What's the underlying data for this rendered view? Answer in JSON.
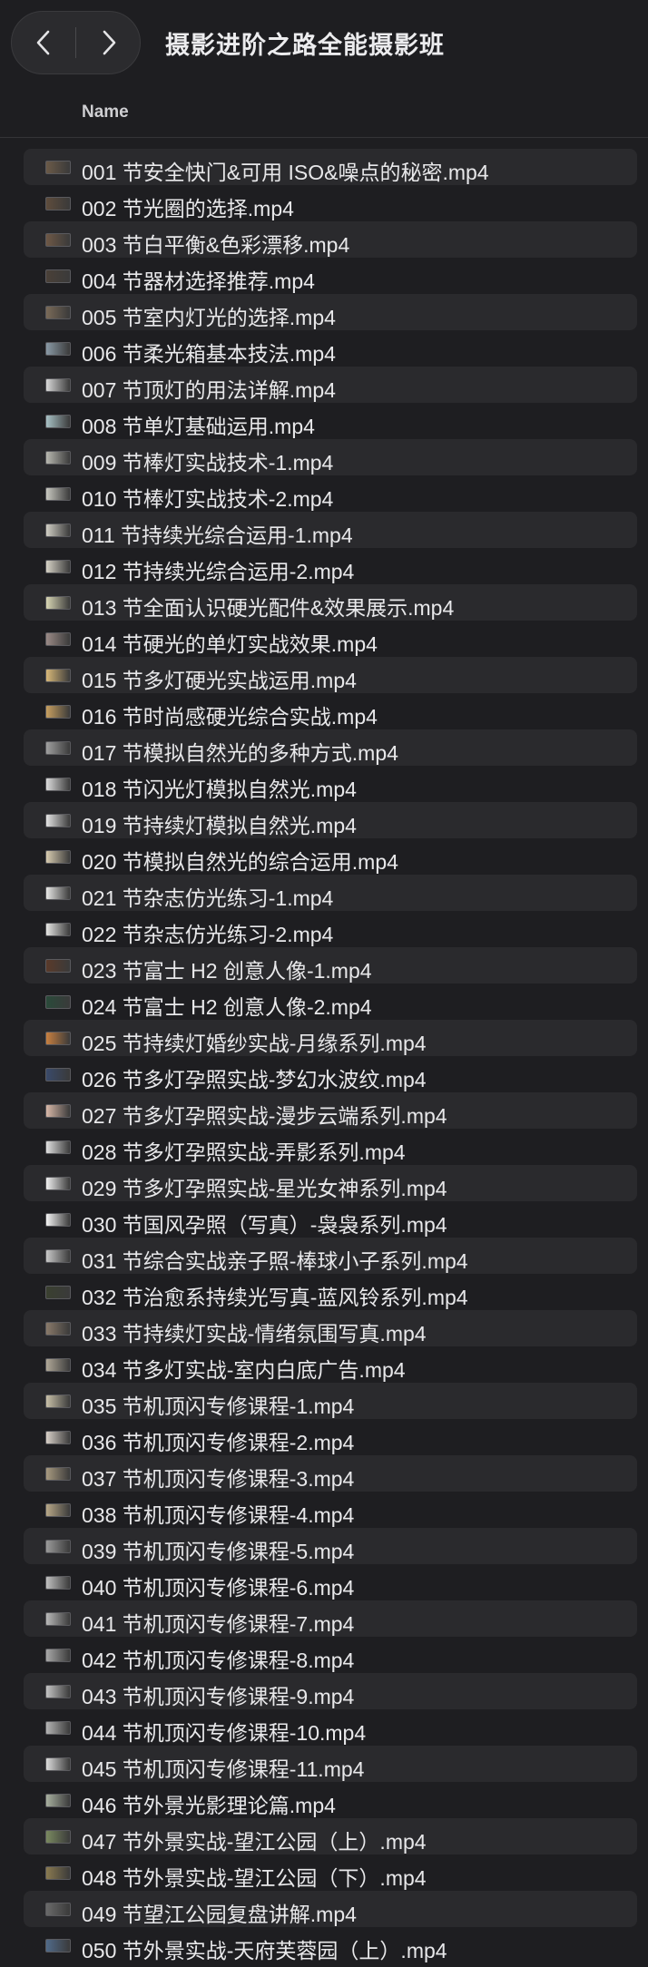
{
  "window": {
    "title": "摄影进阶之路全能摄影班"
  },
  "toolbar": {
    "back_icon": "chevron-left-icon",
    "forward_icon": "chevron-right-icon"
  },
  "columns": {
    "name": "Name"
  },
  "colors": {
    "background": "#1e1e21",
    "row_stripe": "#2a2a2d",
    "text": "#e8e8ea"
  },
  "files": [
    {
      "name": "001 节安全快门&可用 ISO&噪点的秘密.mp4",
      "thumb": "#6b5a48"
    },
    {
      "name": "002 节光圈的选择.mp4",
      "thumb": "#5e4c3c"
    },
    {
      "name": "003 节白平衡&色彩漂移.mp4",
      "thumb": "#6e5846"
    },
    {
      "name": "004 节器材选择推荐.mp4",
      "thumb": "#4a4038"
    },
    {
      "name": "005 节室内灯光的选择.mp4",
      "thumb": "#7a6a58"
    },
    {
      "name": "006 节柔光箱基本技法.mp4",
      "thumb": "#8a9aa6"
    },
    {
      "name": "007 节顶灯的用法详解.mp4",
      "thumb": "#d8d8d8"
    },
    {
      "name": "008 节单灯基础运用.mp4",
      "thumb": "#a8c2c6"
    },
    {
      "name": "009 节棒灯实战技术-1.mp4",
      "thumb": "#b8b8b0"
    },
    {
      "name": "010 节棒灯实战技术-2.mp4",
      "thumb": "#c8c8c0"
    },
    {
      "name": "011 节持续光综合运用-1.mp4",
      "thumb": "#d0cec4"
    },
    {
      "name": "012 节持续光综合运用-2.mp4",
      "thumb": "#d6d2c6"
    },
    {
      "name": "013 节全面认识硬光配件&效果展示.mp4",
      "thumb": "#d8d6b4"
    },
    {
      "name": "014 节硬光的单灯实战效果.mp4",
      "thumb": "#9a8a86"
    },
    {
      "name": "015 节多灯硬光实战运用.mp4",
      "thumb": "#d8b878"
    },
    {
      "name": "016 节时尚感硬光综合实战.mp4",
      "thumb": "#c8a060"
    },
    {
      "name": "017 节模拟自然光的多种方式.mp4",
      "thumb": "#a0a0a0"
    },
    {
      "name": "018 节闪光灯模拟自然光.mp4",
      "thumb": "#dcdcdc"
    },
    {
      "name": "019 节持续灯模拟自然光.mp4",
      "thumb": "#e4e4e4"
    },
    {
      "name": "020 节模拟自然光的综合运用.mp4",
      "thumb": "#d8ccb0"
    },
    {
      "name": "021 节杂志仿光练习-1.mp4",
      "thumb": "#e8e8e6"
    },
    {
      "name": "022 节杂志仿光练习-2.mp4",
      "thumb": "#e6e6e4"
    },
    {
      "name": "023 节富士 H2 创意人像-1.mp4",
      "thumb": "#5a3a2a"
    },
    {
      "name": "024 节富士 H2 创意人像-2.mp4",
      "thumb": "#2a4a3a"
    },
    {
      "name": "025 节持续灯婚纱实战-月缘系列.mp4",
      "thumb": "#c88040"
    },
    {
      "name": "026 节多灯孕照实战-梦幻水波纹.mp4",
      "thumb": "#3a4a6a"
    },
    {
      "name": "027 节多灯孕照实战-漫步云端系列.mp4",
      "thumb": "#d8b8a8"
    },
    {
      "name": "028 节多灯孕照实战-弄影系列.mp4",
      "thumb": "#e0e0e0"
    },
    {
      "name": "029 节多灯孕照实战-星光女神系列.mp4",
      "thumb": "#f0f0f0"
    },
    {
      "name": "030 节国风孕照（写真）-袅袅系列.mp4",
      "thumb": "#f4f4f4"
    },
    {
      "name": "031 节综合实战亲子照-棒球小子系列.mp4",
      "thumb": "#c8c8c8"
    },
    {
      "name": "032 节治愈系持续光写真-蓝风铃系列.mp4",
      "thumb": "#3a4030"
    },
    {
      "name": "033 节持续灯实战-情绪氛围写真.mp4",
      "thumb": "#8a7a6a"
    },
    {
      "name": "034 节多灯实战-室内白底广告.mp4",
      "thumb": "#b0a898"
    },
    {
      "name": "035 节机顶闪专修课程-1.mp4",
      "thumb": "#c8c0a8"
    },
    {
      "name": "036 节机顶闪专修课程-2.mp4",
      "thumb": "#d8d0c8"
    },
    {
      "name": "037 节机顶闪专修课程-3.mp4",
      "thumb": "#a89a80"
    },
    {
      "name": "038 节机顶闪专修课程-4.mp4",
      "thumb": "#b8a888"
    },
    {
      "name": "039 节机顶闪专修课程-5.mp4",
      "thumb": "#9a9a9a"
    },
    {
      "name": "040 节机顶闪专修课程-6.mp4",
      "thumb": "#c0c0c0"
    },
    {
      "name": "041 节机顶闪专修课程-7.mp4",
      "thumb": "#b8b8b8"
    },
    {
      "name": "042 节机顶闪专修课程-8.mp4",
      "thumb": "#a8a8a8"
    },
    {
      "name": "043 节机顶闪专修课程-9.mp4",
      "thumb": "#c4c4c4"
    },
    {
      "name": "044 节机顶闪专修课程-10.mp4",
      "thumb": "#b4b4b4"
    },
    {
      "name": "045 节机顶闪专修课程-11.mp4",
      "thumb": "#dcdcdc"
    },
    {
      "name": "046 节外景光影理论篇.mp4",
      "thumb": "#a8b0a0"
    },
    {
      "name": "047 节外景实战-望江公园（上）.mp4",
      "thumb": "#7a8a60"
    },
    {
      "name": "048 节外景实战-望江公园（下）.mp4",
      "thumb": "#8a7a50"
    },
    {
      "name": "049 节望江公园复盘讲解.mp4",
      "thumb": "#6a6a6a"
    },
    {
      "name": "050 节外景实战-天府芙蓉园（上）.mp4",
      "thumb": "#506a8a"
    }
  ]
}
